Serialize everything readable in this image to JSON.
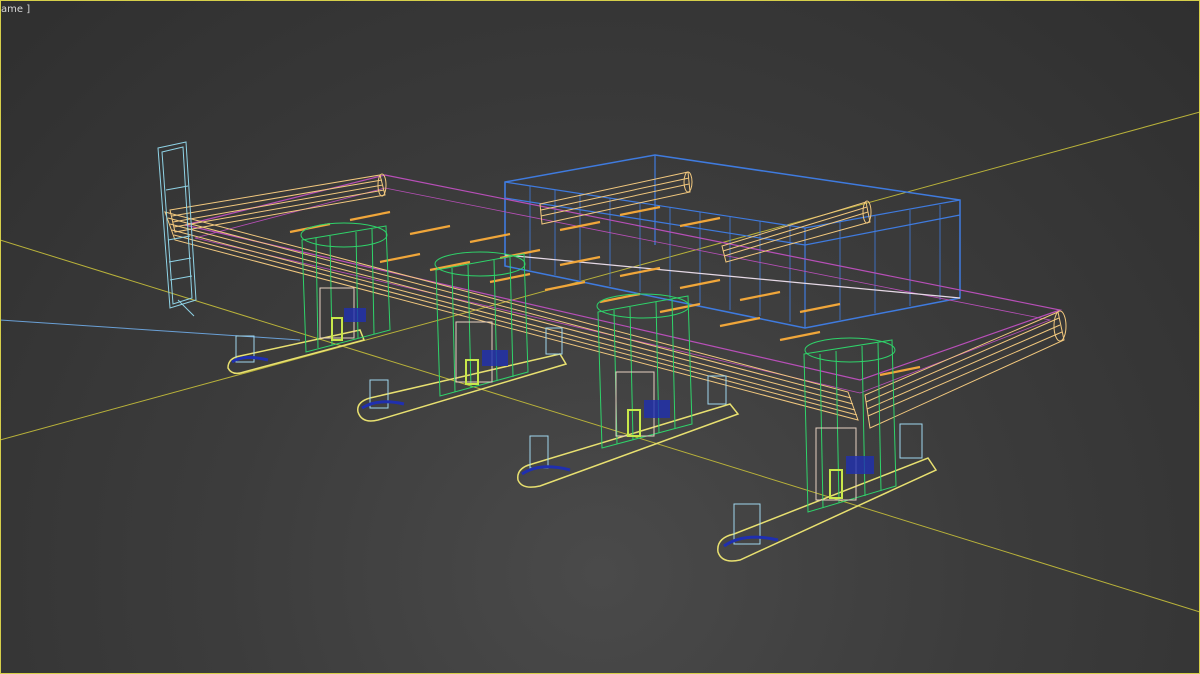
{
  "viewport": {
    "label": "ame ]",
    "colors": {
      "background": "#3c3c3c",
      "border": "#d6cf4a",
      "grid_axis": "#b9b23a",
      "axis_blue": "#6aa0d6",
      "canopy": "#f2c87e",
      "building": "#3f7bdf",
      "outline_magenta": "#b84fb8",
      "pump_column": "#2fd36a",
      "island": "#e8e070",
      "dispenser": "#9fd6ee",
      "sign": "#8fd3e6",
      "lights": "#f0a63a"
    }
  },
  "scene": {
    "objects": [
      "pylon-sign",
      "canopy-roof",
      "convenience-store",
      "pump-island-1",
      "pump-island-2",
      "pump-island-3",
      "pump-island-4"
    ]
  }
}
